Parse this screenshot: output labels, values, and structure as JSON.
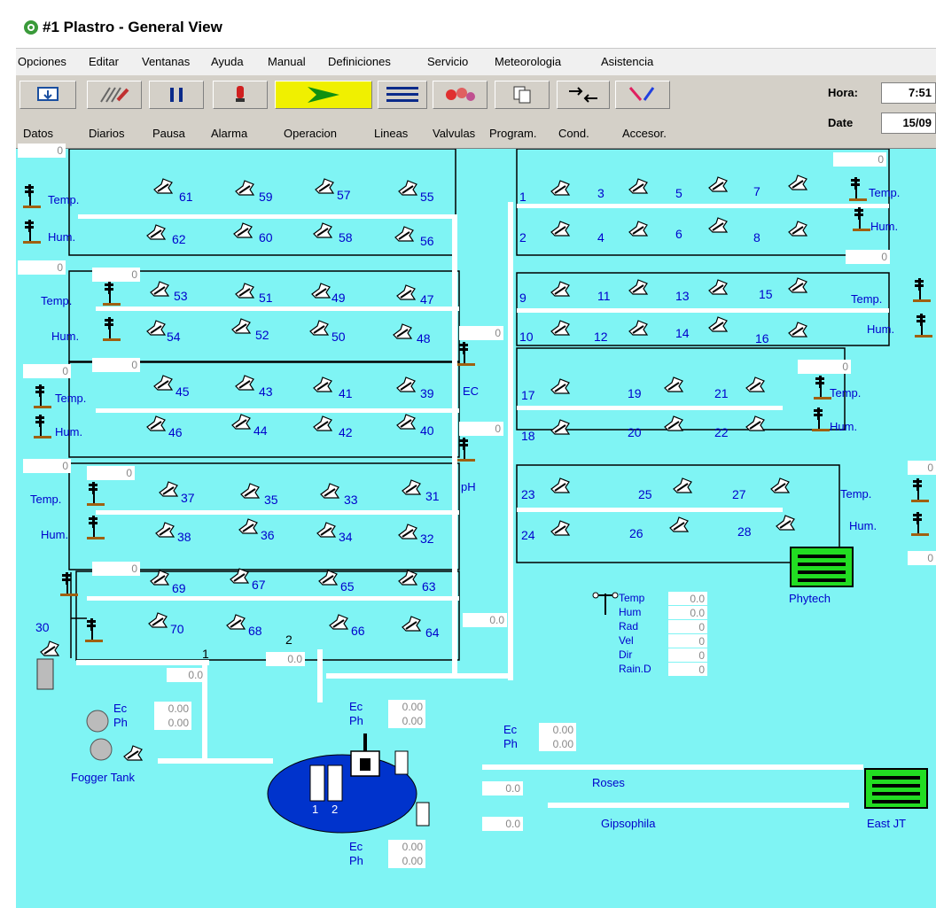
{
  "window": {
    "title": "#1 Plastro - General View"
  },
  "menu": [
    "Opciones",
    "Editar",
    "Ventanas",
    "Ayuda",
    "Manual",
    "Definiciones",
    "Servicio",
    "Meteorologia",
    "Asistencia"
  ],
  "toolbar": {
    "buttons": [
      "Datos",
      "Diarios",
      "Pausa",
      "Alarma",
      "Operacion",
      "Lineas",
      "Valvulas",
      "Program.",
      "Cond.",
      "Accesor."
    ],
    "hora_label": "Hora:",
    "hora_value": "7:51",
    "date_label": "Date",
    "date_value": "15/09"
  },
  "sensor_labels": {
    "temp": "Temp.",
    "hum": "Hum.",
    "ec": "EC",
    "ph": "pH"
  },
  "zero": "0",
  "valve_numbers_left": {
    "row1": [
      "61",
      "59",
      "57",
      "55"
    ],
    "row2": [
      "62",
      "60",
      "58",
      "56"
    ],
    "row3": [
      "53",
      "51",
      "49",
      "47"
    ],
    "row4": [
      "54",
      "52",
      "50",
      "48"
    ],
    "row5": [
      "45",
      "43",
      "41",
      "39"
    ],
    "row6": [
      "46",
      "44",
      "42",
      "40"
    ],
    "row7": [
      "37",
      "35",
      "33",
      "31"
    ],
    "row8": [
      "38",
      "36",
      "34",
      "32"
    ],
    "row9": [
      "69",
      "67",
      "65",
      "63"
    ],
    "row10": [
      "70",
      "68",
      "66",
      "64"
    ]
  },
  "valve_numbers_right": {
    "row1": [
      "1",
      "3",
      "5",
      "7"
    ],
    "row2": [
      "2",
      "4",
      "6",
      "8"
    ],
    "row3": [
      "9",
      "11",
      "13",
      "15"
    ],
    "row4": [
      "10",
      "12",
      "14",
      "16"
    ],
    "row5": [
      "17",
      "19",
      "21"
    ],
    "row6": [
      "18",
      "20",
      "22"
    ],
    "row7": [
      "23",
      "25",
      "27"
    ],
    "row8": [
      "24",
      "26",
      "28"
    ]
  },
  "misc": {
    "valve30": "30",
    "line1": "1",
    "line2": "2",
    "val_00": "0.0",
    "val_000": "0.00",
    "ec": "Ec",
    "ph": "Ph",
    "fogger_tank": "Fogger Tank",
    "tank1": "1",
    "tank2": "2",
    "roses": "Roses",
    "gipsophila": "Gipsophila",
    "phytech": "Phytech",
    "east_jt": "East JT"
  },
  "weather": [
    {
      "label": "Temp",
      "value": "0.0"
    },
    {
      "label": "Hum",
      "value": "0.0"
    },
    {
      "label": "Rad",
      "value": "0"
    },
    {
      "label": "Vel",
      "value": "0"
    },
    {
      "label": "Dir",
      "value": "0"
    },
    {
      "label": "Rain.D",
      "value": "0"
    }
  ],
  "colors": {
    "canvas": "#7ff4f4",
    "blue_text": "#0000cc",
    "tank": "#0033cc",
    "green": "#22dd22"
  }
}
